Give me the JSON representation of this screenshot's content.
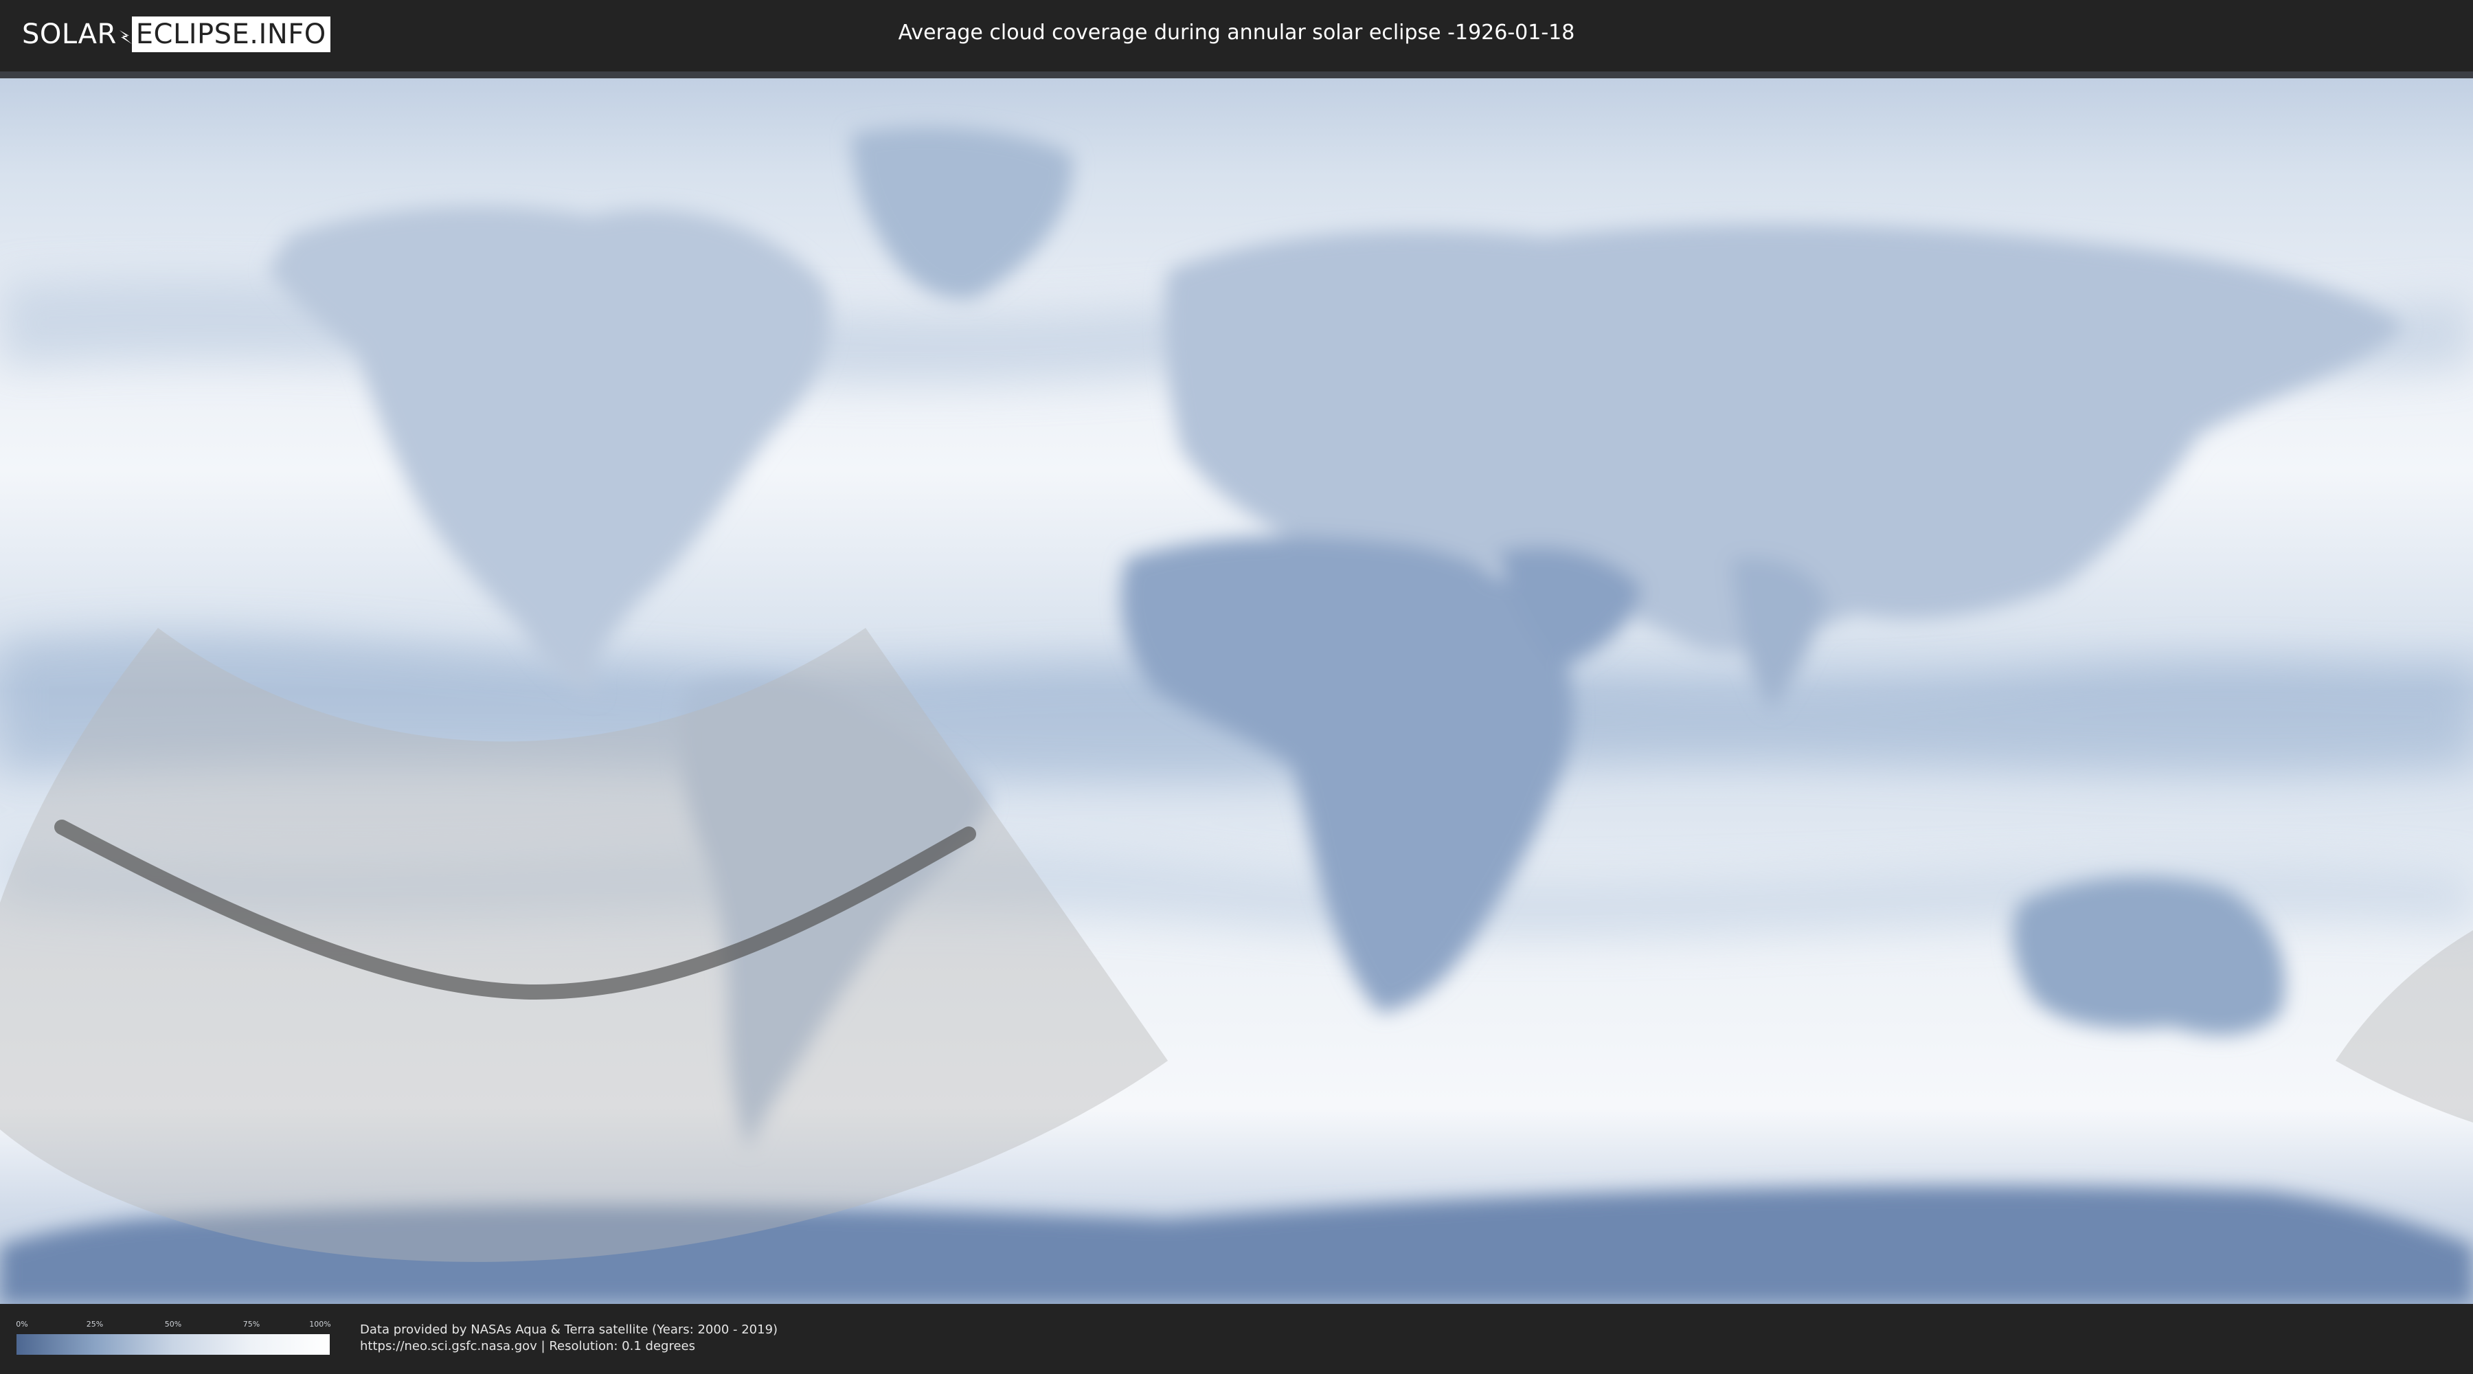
{
  "brand": {
    "left": "SOLAR",
    "right": "ECLIPSE.INFO"
  },
  "title": "Average cloud coverage during annular solar eclipse -1926-01-18",
  "legend": {
    "ticks": [
      "0%",
      "25%",
      "50%",
      "75%",
      "100%"
    ]
  },
  "credits": {
    "line1": "Data provided by NASAs Aqua & Terra satellite (Years: 2000 - 2019)",
    "line2": "https://neo.sci.gsfc.nasa.gov | Resolution: 0.1 degrees"
  },
  "colors": {
    "background": "#232323",
    "cloud_low": "#4d6791",
    "cloud_high": "#ffffff",
    "eclipse_overlay": "#b8b8b8",
    "central_path": "#555555"
  }
}
